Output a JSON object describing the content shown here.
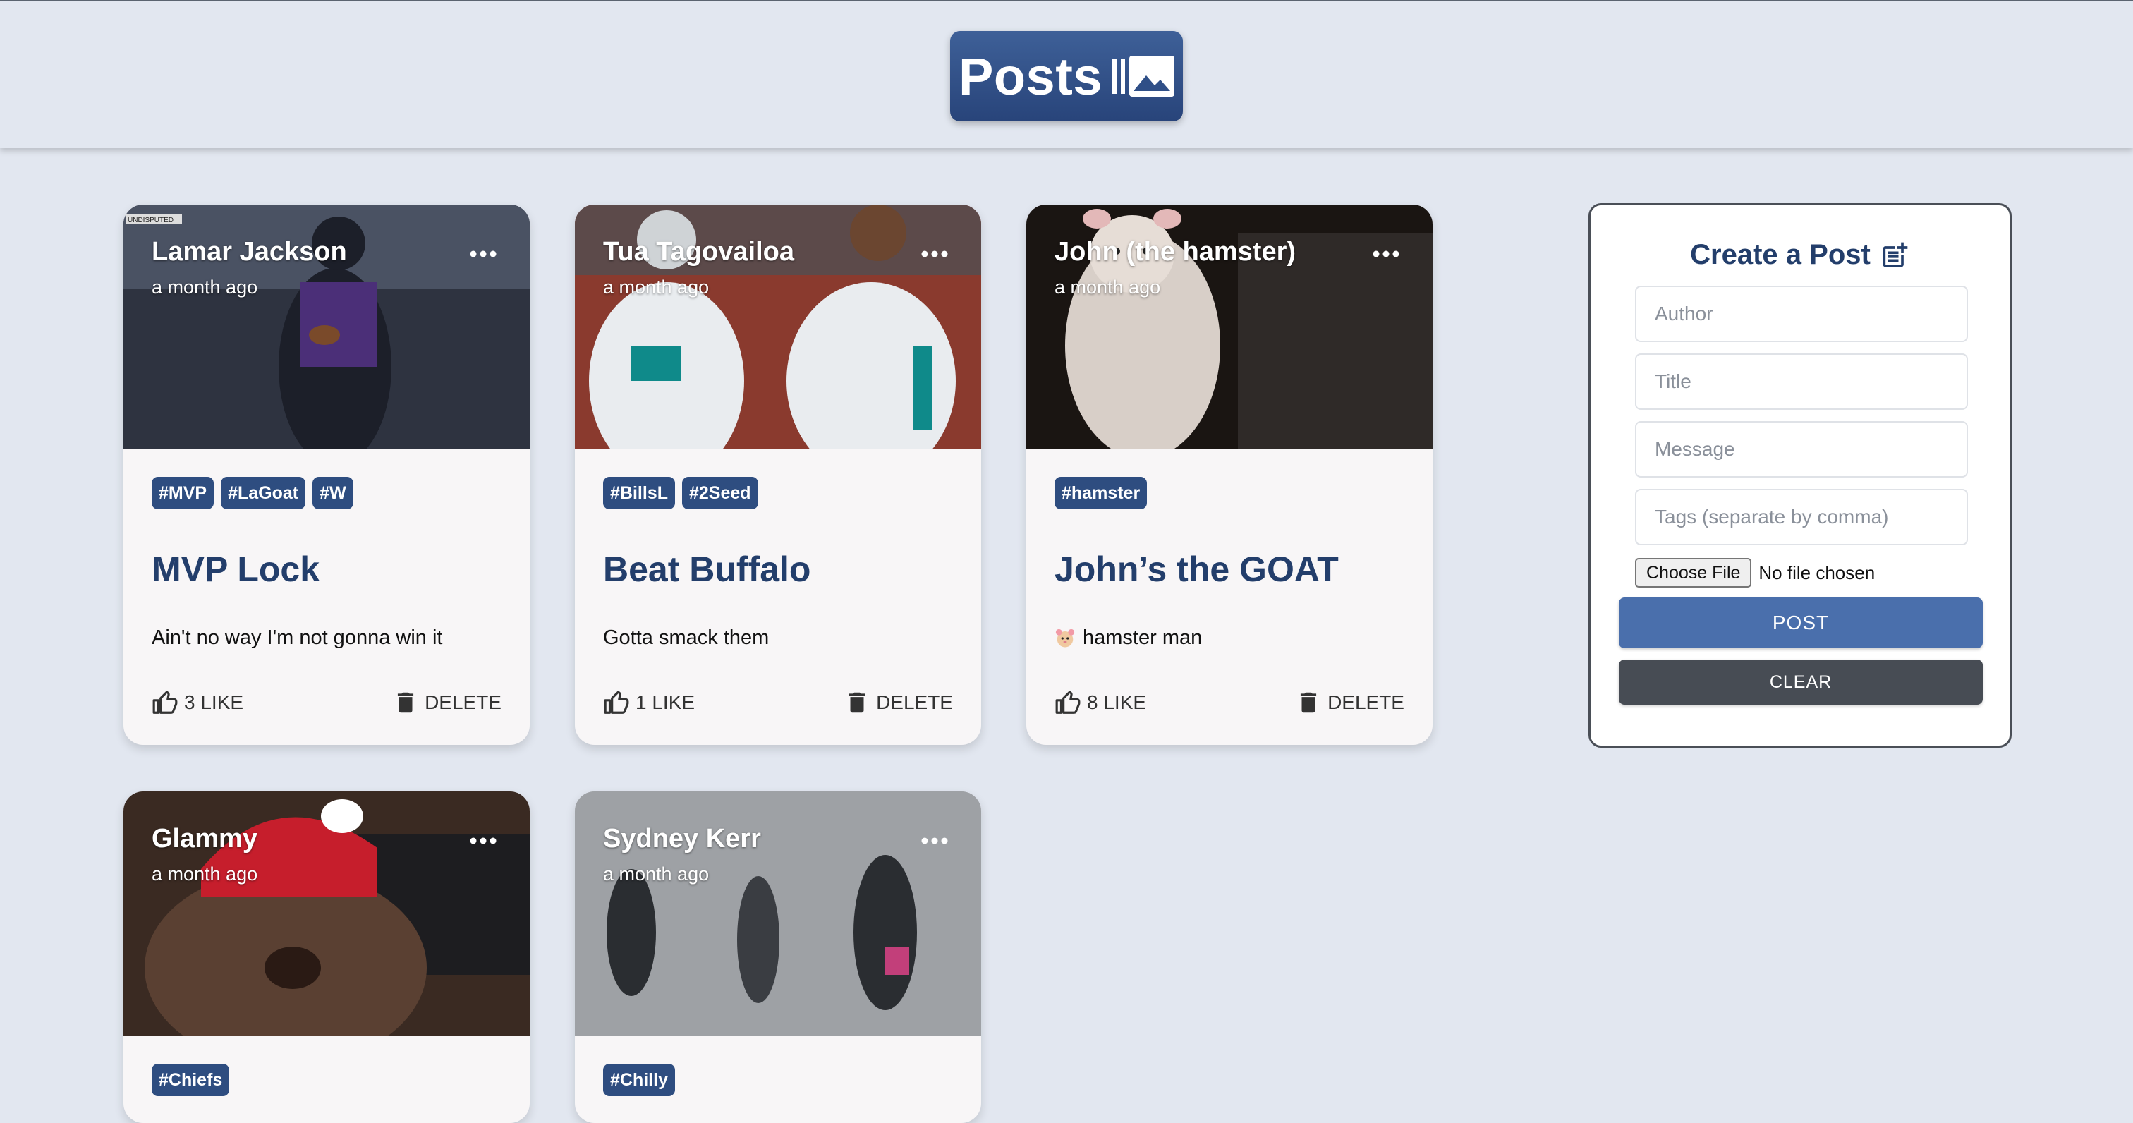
{
  "header": {
    "title": "Posts",
    "icon": "photo-library-icon"
  },
  "posts": [
    {
      "author": "Lamar Jackson",
      "time": "a month ago",
      "tags": [
        "#MVP",
        "#LaGoat",
        "#W"
      ],
      "title": "MVP Lock",
      "message": "Ain't no way I'm not gonna win it",
      "likes": "3 LIKE",
      "delete": "DELETE",
      "image": {
        "bg": "#2e3340",
        "accent": "#4b2f78",
        "caption": "UNDISPUTED"
      }
    },
    {
      "author": "Tua Tagovailoa",
      "time": "a month ago",
      "tags": [
        "#BillsL",
        "#2Seed"
      ],
      "title": "Beat Buffalo",
      "message": "Gotta smack them",
      "likes": "1 LIKE",
      "delete": "DELETE",
      "image": {
        "bg": "#8a3a2e",
        "accent": "#e9ecef"
      }
    },
    {
      "author": "John (the hamster)",
      "time": "a month ago",
      "tags": [
        "#hamster"
      ],
      "title": "John’s the GOAT",
      "message": "hamster man",
      "message_icon": "hamster-emoji-icon",
      "likes": "8 LIKE",
      "delete": "DELETE",
      "image": {
        "bg": "#1a1512",
        "accent": "#d8cfc8"
      }
    },
    {
      "author": "Glammy",
      "time": "a month ago",
      "tags": [
        "#Chiefs"
      ],
      "image": {
        "bg": "#3a2a22",
        "accent": "#c61e2c"
      }
    },
    {
      "author": "Sydney Kerr",
      "time": "a month ago",
      "tags": [
        "#Chilly"
      ],
      "image": {
        "bg": "#6f7479",
        "accent": "#d7d9dc"
      }
    }
  ],
  "form": {
    "title": "Create a Post",
    "author_placeholder": "Author",
    "title_placeholder": "Title",
    "message_placeholder": "Message",
    "tags_placeholder": "Tags (separate by comma)",
    "file_button": "Choose File",
    "file_status": "No file chosen",
    "post_label": "POST",
    "clear_label": "CLEAR"
  },
  "colors": {
    "page_bg": "#e2e7f0",
    "brand": "#2f4f87",
    "tag_bg": "#2e4d80",
    "title_text": "#233e6b",
    "post_button": "#4a6fac",
    "clear_button": "#474c54"
  }
}
